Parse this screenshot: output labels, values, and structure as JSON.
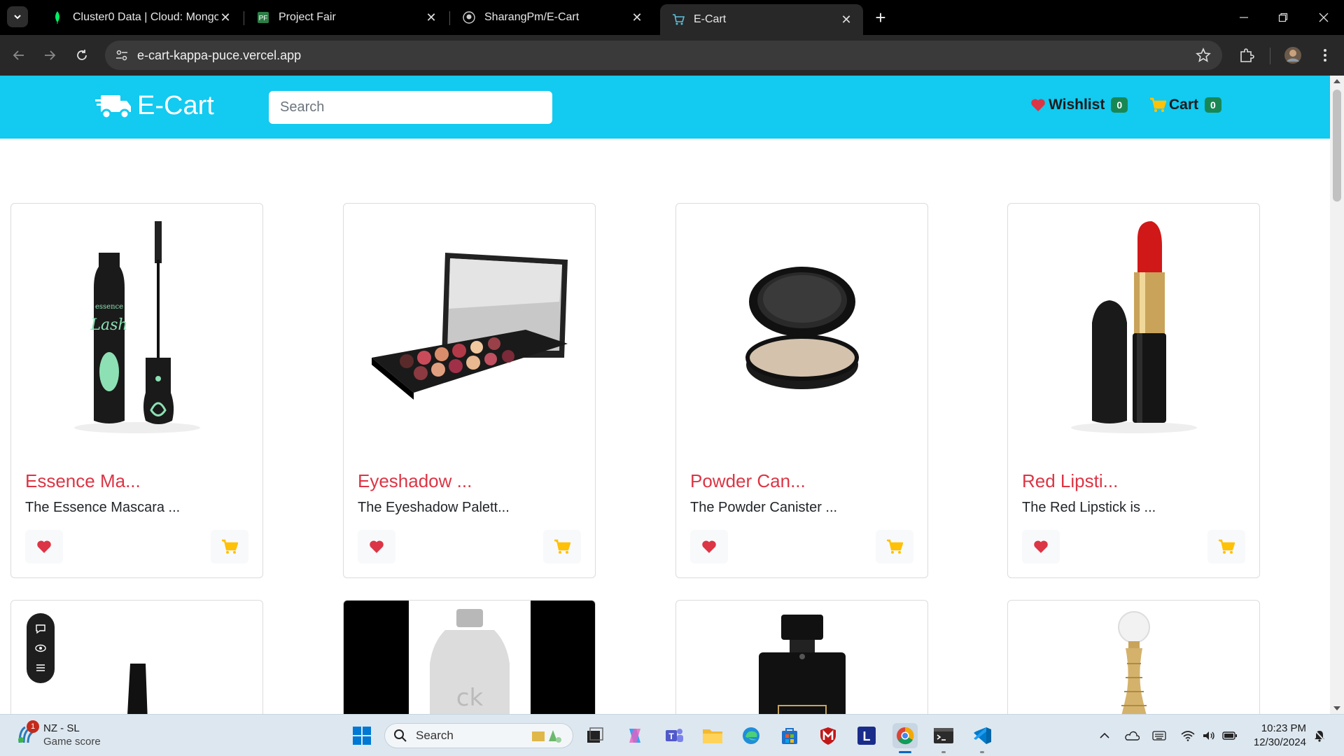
{
  "browser": {
    "tabs": [
      {
        "title": "Cluster0 Data | Cloud: MongoDB",
        "favicon": "mongodb-leaf-icon",
        "active": false
      },
      {
        "title": "Project Fair",
        "favicon": "project-icon",
        "active": false
      },
      {
        "title": "SharangPm/E-Cart",
        "favicon": "github-icon",
        "active": false
      },
      {
        "title": "E-Cart",
        "favicon": "cart-icon",
        "active": true
      }
    ],
    "url": "e-cart-kappa-puce.vercel.app"
  },
  "site": {
    "brand": "E-Cart",
    "search_placeholder": "Search",
    "wishlist_label": "Wishlist",
    "wishlist_count": "0",
    "cart_label": "Cart",
    "cart_count": "0",
    "colors": {
      "navbar": "#13caf0",
      "title": "#dc3545",
      "heart": "#dc3545",
      "cart": "#ffc107",
      "badge": "#198754"
    }
  },
  "products": [
    {
      "name": "Essence Ma...",
      "desc": "The Essence Mascara ..."
    },
    {
      "name": "Eyeshadow ...",
      "desc": "The Eyeshadow Palett..."
    },
    {
      "name": "Powder Can...",
      "desc": "The Powder Canister ..."
    },
    {
      "name": "Red Lipsti...",
      "desc": "The Red Lipstick is ..."
    }
  ],
  "taskbar": {
    "weather_title": "NZ - SL",
    "weather_sub": "Game score",
    "weather_badge": "1",
    "search_label": "Search",
    "time": "10:23 PM",
    "date": "12/30/2024"
  }
}
